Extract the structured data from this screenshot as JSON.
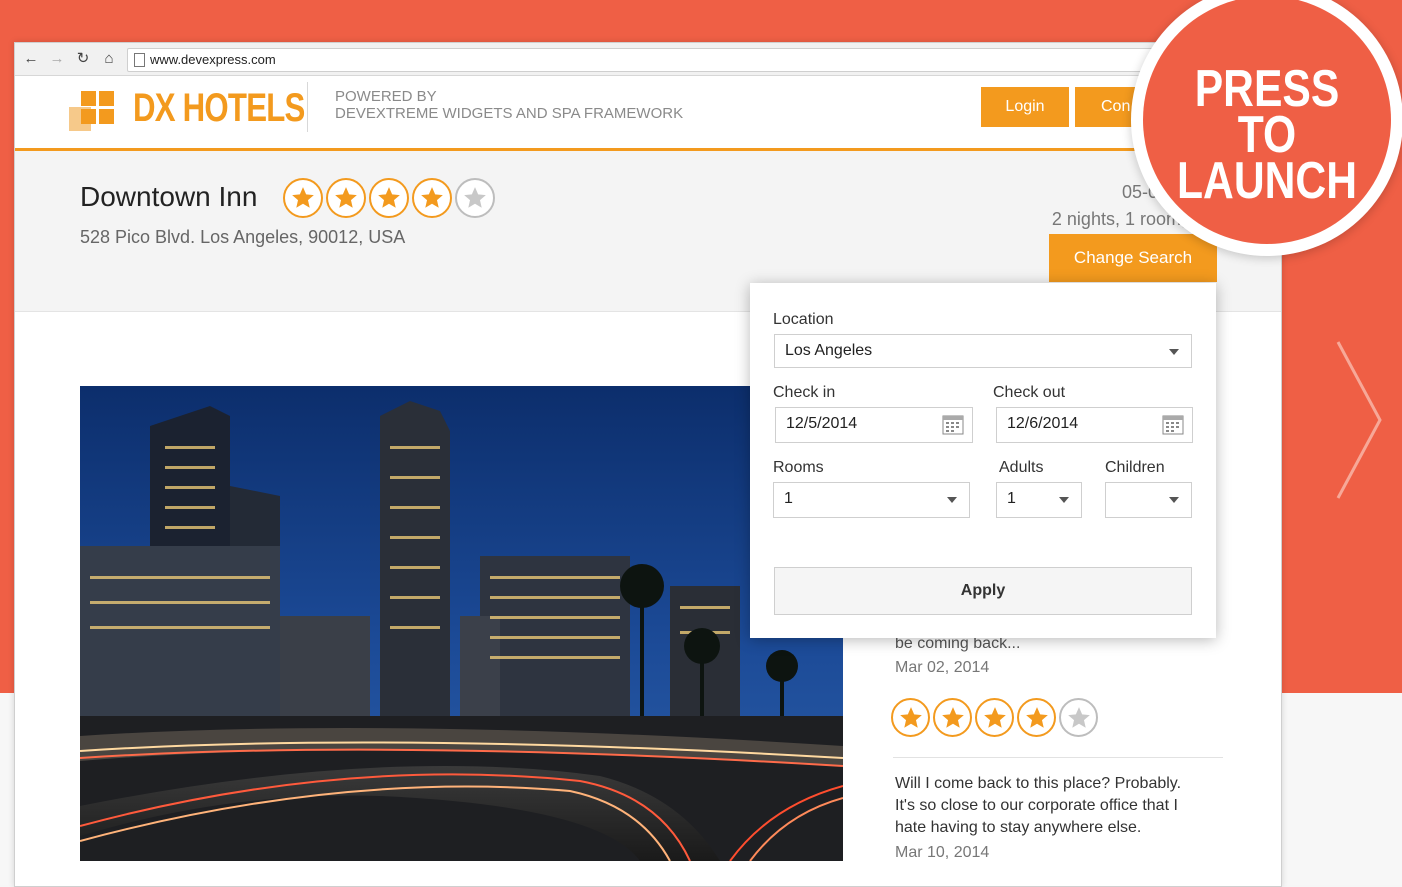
{
  "browser": {
    "url": "www.devexpress.com"
  },
  "header": {
    "logo_text": "DX HOTELS",
    "powered_line1": "POWERED BY",
    "powered_line2": "DEVEXTREME WIDGETS AND SPA FRAMEWORK",
    "login_label": "Login",
    "second_button_label": "Con"
  },
  "hotel": {
    "name": "Downtown Inn",
    "rating": 4,
    "max_rating": 5,
    "address": "528 Pico Blvd. Los Angeles, 90012, USA",
    "dates_line1": "05-07, De",
    "dates_line2": "2 nights, 1 room, 1",
    "change_search_label": "Change Search"
  },
  "search_popup": {
    "location_label": "Location",
    "location_value": "Los Angeles",
    "checkin_label": "Check in",
    "checkin_value": "12/5/2014",
    "checkout_label": "Check out",
    "checkout_value": "12/6/2014",
    "rooms_label": "Rooms",
    "rooms_value": "1",
    "adults_label": "Adults",
    "adults_value": "1",
    "children_label": "Children",
    "children_value": "",
    "apply_label": "Apply"
  },
  "reviews": [
    {
      "text_partial": "be coming back...",
      "date": "Mar 02, 2014",
      "rating": 4
    },
    {
      "text_line1": "Will I come back to this place? Probably.",
      "text_line2": "It's so close to our corporate office that I",
      "text_line3": "hate having to stay anywhere else.",
      "date": "Mar 10, 2014"
    }
  ],
  "overlay": {
    "press_line1": "PRESS TO",
    "press_line2": "LAUNCH"
  },
  "colors": {
    "accent": "#f39a1e",
    "coral": "#ef5f45"
  }
}
